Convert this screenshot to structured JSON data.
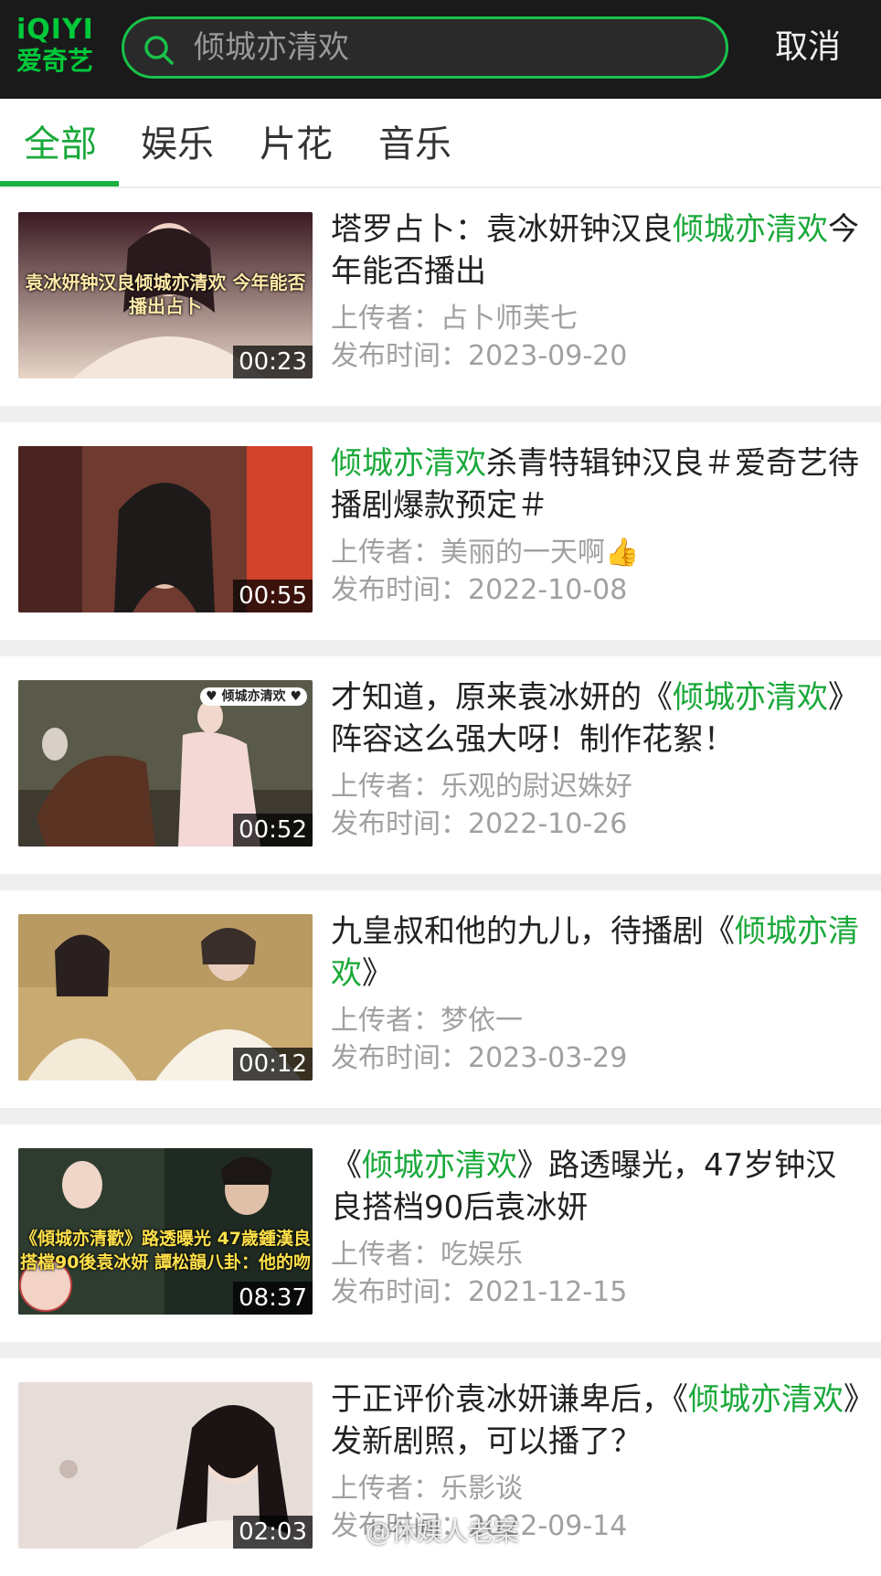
{
  "header": {
    "logo_en": "iQIYI",
    "logo_cn": "爱奇艺",
    "search_value": "倾城亦清欢",
    "cancel_label": "取消"
  },
  "tabs": [
    {
      "label": "全部",
      "active": true
    },
    {
      "label": "娱乐",
      "active": false
    },
    {
      "label": "片花",
      "active": false
    },
    {
      "label": "音乐",
      "active": false
    }
  ],
  "results": [
    {
      "title_parts": [
        {
          "text": "塔罗占卜：袁冰妍钟汉良",
          "hl": false
        },
        {
          "text": "倾城亦清欢",
          "hl": true
        },
        {
          "text": "今年能否播出",
          "hl": false
        }
      ],
      "uploader": "上传者：占卜师芙七",
      "date": "发布时间：2023-09-20",
      "duration": "00:23",
      "overlay": "袁冰妍钟汉良倾城亦清欢 今年能否播出占卜"
    },
    {
      "title_parts": [
        {
          "text": "倾城亦清欢",
          "hl": true
        },
        {
          "text": "杀青特辑钟汉良＃爱奇艺待播剧爆款预定＃",
          "hl": false
        }
      ],
      "uploader": "上传者：美丽的一天啊👍",
      "date": "发布时间：2022-10-08",
      "duration": "00:55",
      "overlay": ""
    },
    {
      "title_parts": [
        {
          "text": "才知道，原来袁冰妍的《",
          "hl": false
        },
        {
          "text": "倾城亦清欢",
          "hl": true
        },
        {
          "text": "》阵容这么强大呀！制作花絮！",
          "hl": false
        }
      ],
      "uploader": "上传者：乐观的尉迟姝好",
      "date": "发布时间：2022-10-26",
      "duration": "00:52",
      "overlay": "♥ 倾城亦清欢 ♥"
    },
    {
      "title_parts": [
        {
          "text": "九皇叔和他的九儿，待播剧《",
          "hl": false
        },
        {
          "text": "倾城亦清欢",
          "hl": true
        },
        {
          "text": "》",
          "hl": false
        }
      ],
      "uploader": "上传者：梦依一",
      "date": "发布时间：2023-03-29",
      "duration": "00:12",
      "overlay": ""
    },
    {
      "title_parts": [
        {
          "text": "《",
          "hl": false
        },
        {
          "text": "倾城亦清欢",
          "hl": true
        },
        {
          "text": "》路透曝光，47岁钟汉良搭档90后袁冰妍",
          "hl": false
        }
      ],
      "uploader": "上传者：吃娱乐",
      "date": "发布时间：2021-12-15",
      "duration": "08:37",
      "overlay": "《傾城亦清歡》路透曝光 47歲鍾漢良搭檔90後袁冰妍 譚松韻八卦：他的吻"
    },
    {
      "title_parts": [
        {
          "text": "于正评价袁冰妍谦卑后，《",
          "hl": false
        },
        {
          "text": "倾城亦清",
          "hl": true
        },
        {
          "text": "欢",
          "hl": true
        },
        {
          "text": "》发新剧照，可以播了？",
          "hl": false
        }
      ],
      "uploader": "上传者：乐影谈",
      "date": "发布时间：2022-09-14",
      "duration": "02:03",
      "overlay": ""
    }
  ],
  "watermark": "@休娱人老案"
}
